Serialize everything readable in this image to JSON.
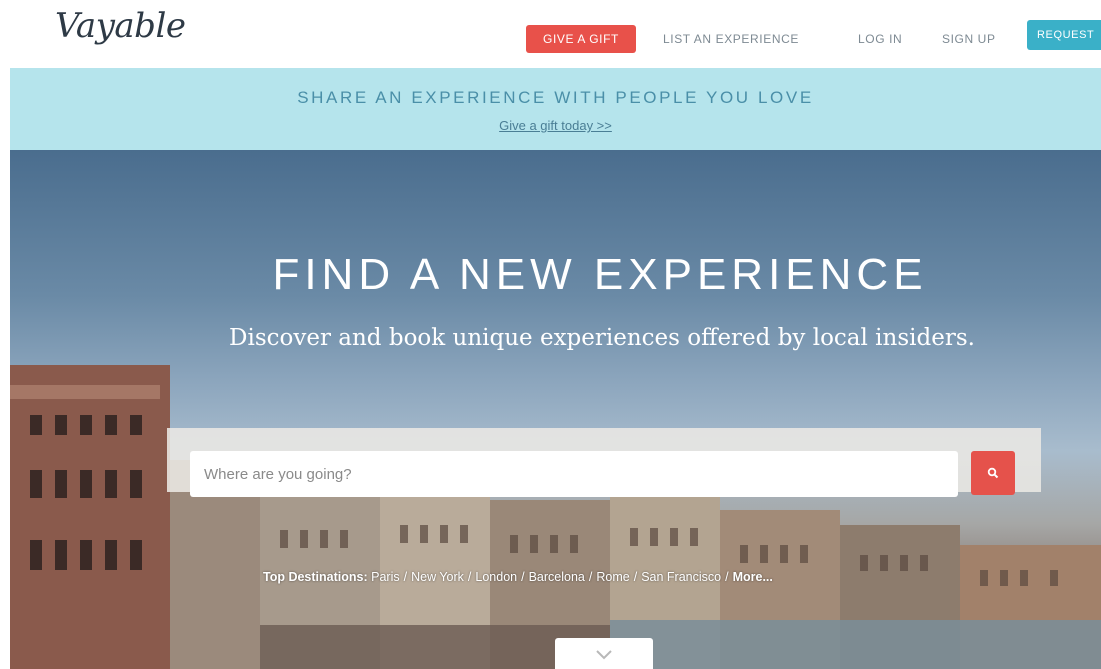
{
  "header": {
    "logo": "Vayable",
    "nav": {
      "give_gift": "GIVE A GIFT",
      "list_experience": "LIST AN EXPERIENCE",
      "login": "LOG IN",
      "signup": "SIGN UP",
      "request": "REQUEST"
    }
  },
  "promo": {
    "title": "SHARE AN EXPERIENCE WITH PEOPLE YOU LOVE",
    "link": "Give a gift today >>"
  },
  "hero": {
    "title": "FIND A NEW EXPERIENCE",
    "subtitle": "Discover and book unique experiences offered by local insiders.",
    "search": {
      "placeholder": "Where are you going?",
      "value": ""
    },
    "destinations": {
      "label": "Top Destinations:",
      "items": [
        "Paris",
        "New York",
        "London",
        "Barcelona",
        "Rome",
        "San Francisco"
      ],
      "more": "More..."
    }
  },
  "colors": {
    "gift_button": "#e8514a",
    "request_button": "#3ab0c8",
    "promo_background": "#b5e4ec",
    "search_button": "#e5524b"
  },
  "icons": {
    "search_button": "search-icon",
    "scroll": "chevron-down-icon"
  }
}
